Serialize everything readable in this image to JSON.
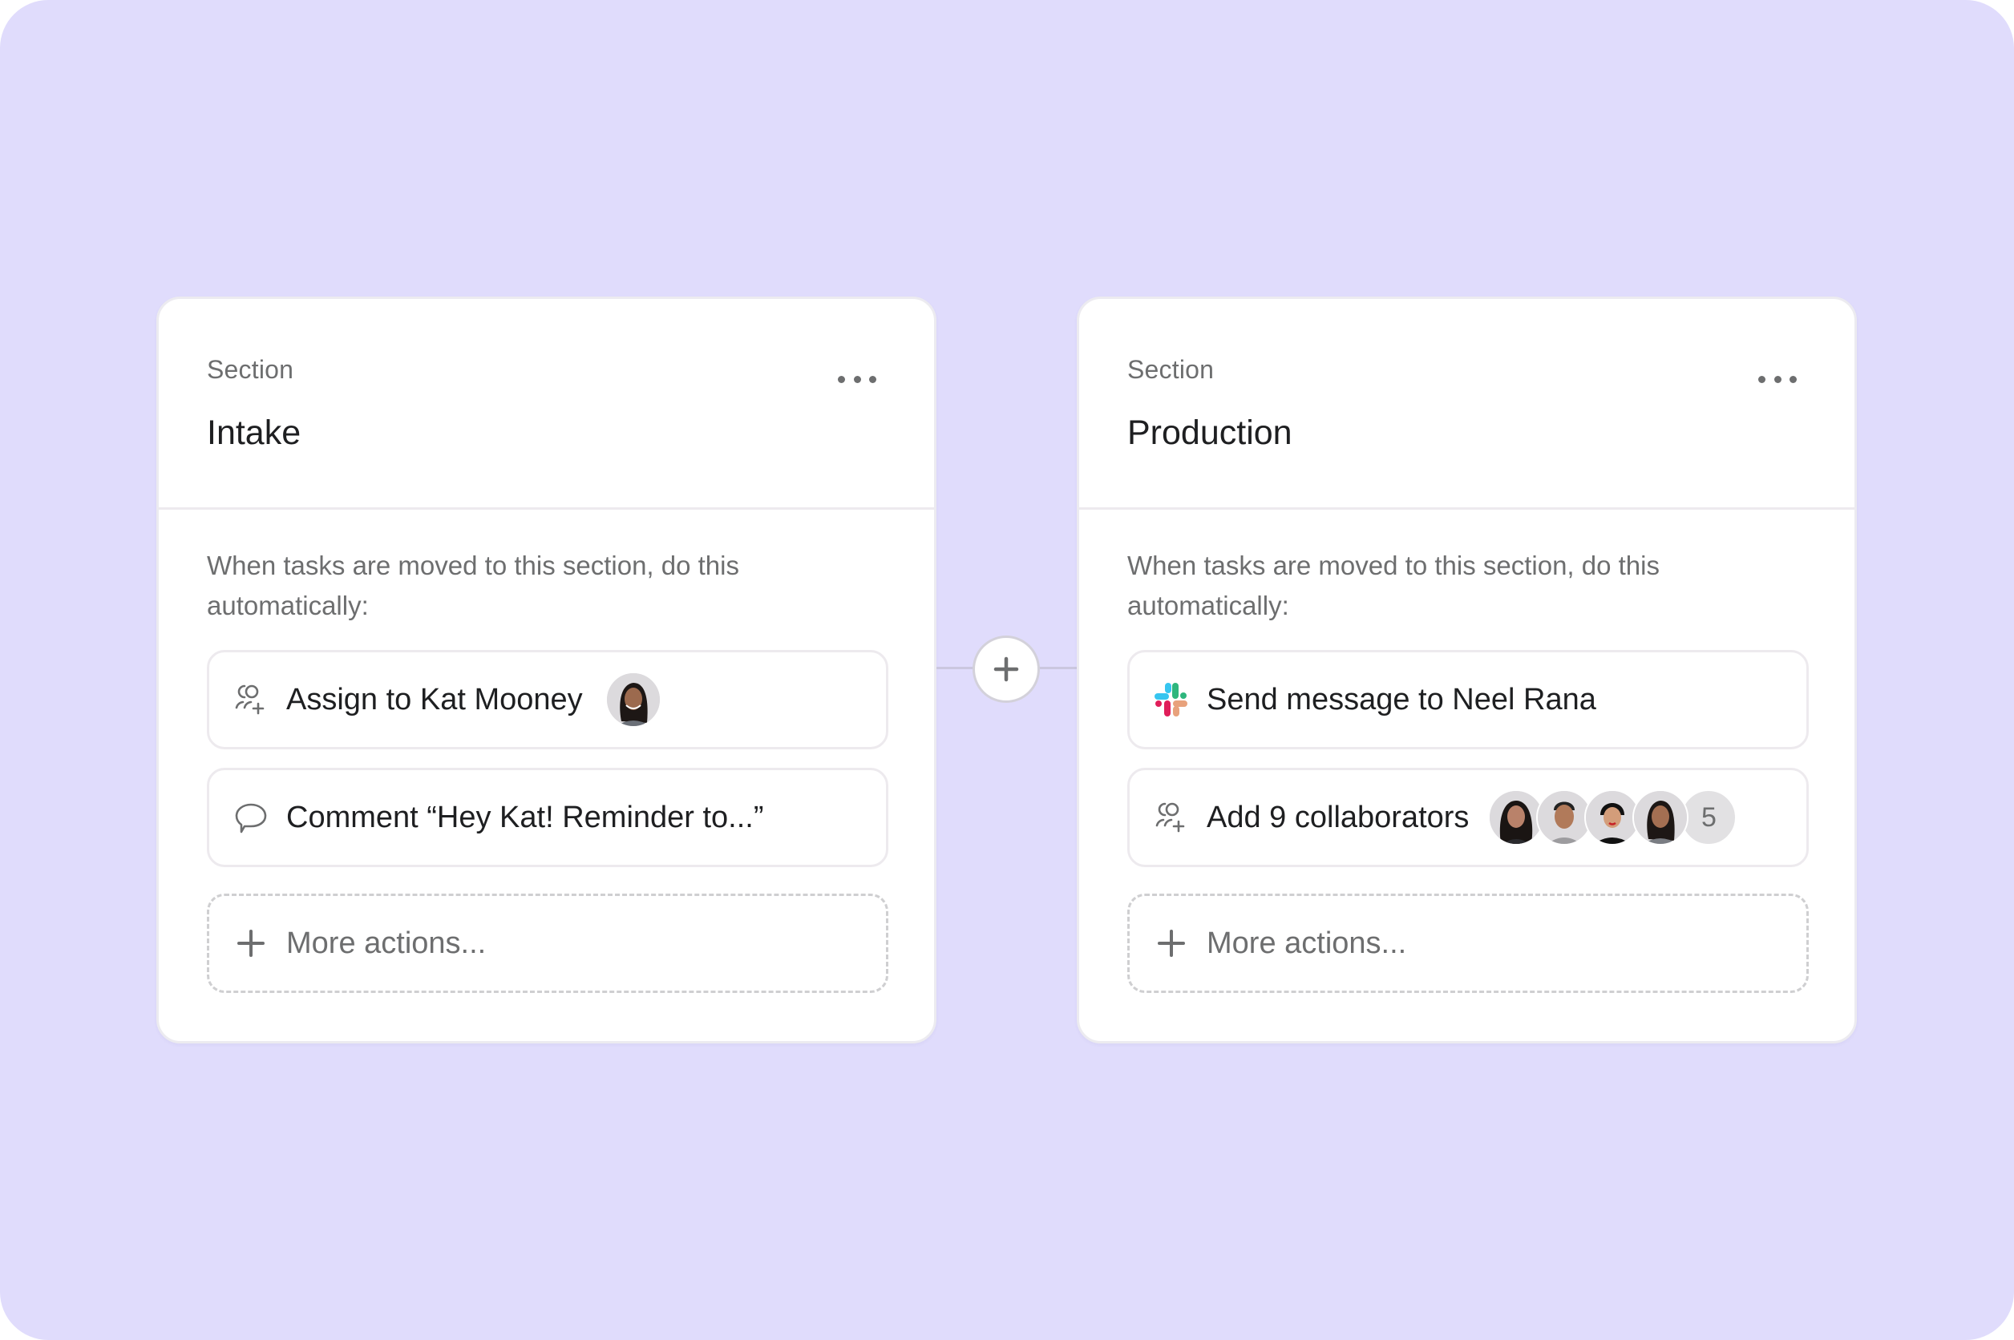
{
  "colors": {
    "background": "#e0dcfc",
    "card": "#ffffff",
    "text_primary": "#1e1f21",
    "text_secondary": "#6d6e6f",
    "slack_blue": "#36c5f0",
    "slack_green": "#2eb67d",
    "slack_red": "#e01e5a",
    "slack_peach": "#e8a27c"
  },
  "connector": {
    "add_button_icon": "plus-icon"
  },
  "sections": [
    {
      "label": "Section",
      "title": "Intake",
      "menu_icon": "more-horizontal-icon",
      "description": "When tasks are moved to this section, do this automatically:",
      "actions": [
        {
          "icon": "assign-user-icon",
          "label": "Assign to Kat Mooney",
          "avatar": "Kat Mooney"
        },
        {
          "icon": "comment-icon",
          "label": "Comment “Hey Kat! Reminder to...”"
        }
      ],
      "more_actions": {
        "icon": "plus-icon",
        "label": "More actions..."
      }
    },
    {
      "label": "Section",
      "title": "Production",
      "menu_icon": "more-horizontal-icon",
      "description": "When tasks are moved to this section, do this automatically:",
      "actions": [
        {
          "icon": "slack-icon",
          "label": "Send message to Neel Rana"
        },
        {
          "icon": "add-collaborators-icon",
          "label": "Add 9 collaborators",
          "avatars_shown": 4,
          "overflow_count": "5"
        }
      ],
      "more_actions": {
        "icon": "plus-icon",
        "label": "More actions..."
      }
    }
  ]
}
